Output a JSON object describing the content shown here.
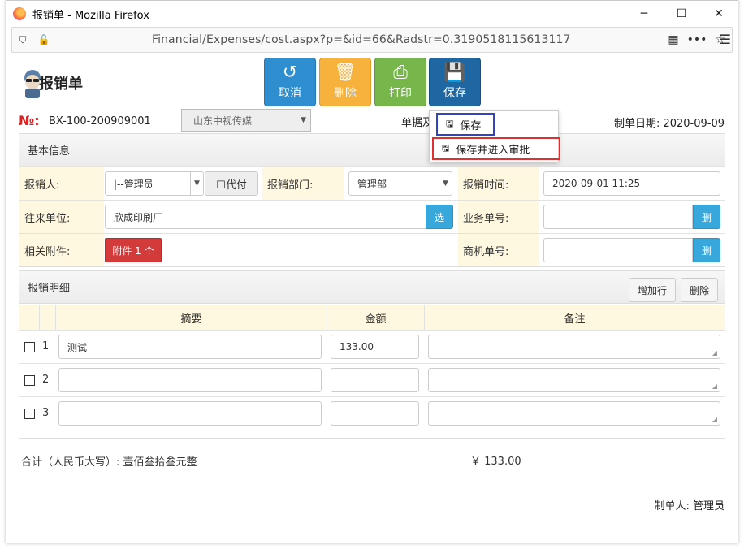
{
  "browser": {
    "window_title": "报销单 - Mozilla Firefox",
    "url": "Financial/Expenses/cost.aspx?p=&id=66&Radstr=0.3190518115613117",
    "minimize": "─",
    "maximize": "☐",
    "close": "✕"
  },
  "header": {
    "doc_title": "报销单",
    "no_label": "№:",
    "no_value": "BX-100-200909001",
    "company": "山东中视传媒",
    "doc_date_label": "单据及",
    "make_date": "制单日期: 2020-09-09"
  },
  "toolbar": {
    "cancel": "取消",
    "delete": "删除",
    "print": "打印",
    "save": "保存"
  },
  "save_menu": {
    "save": "保存",
    "save_submit": "保存并进入审批"
  },
  "basic": {
    "title": "基本信息",
    "applicant_label": "报销人:",
    "applicant_value": "|--管理员",
    "proxy_label": "☐代付",
    "dept_label": "报销部门:",
    "dept_value": "管理部",
    "time_label": "报销时间:",
    "time_value": "2020-09-01 11:25",
    "partner_label": "往来单位:",
    "partner_value": "欣成印刷厂",
    "partner_btn": "选",
    "bizno_label": "业务单号:",
    "bizno_btn": "删",
    "attach_label": "相关附件:",
    "attach_btn": "附件 1 个",
    "oppno_label": "商机单号:",
    "oppno_btn": "删"
  },
  "detail": {
    "title": "报销明细",
    "add_row": "增加行",
    "delete": "删除",
    "columns": [
      "摘要",
      "金额",
      "备注"
    ],
    "rows": [
      {
        "num": "1",
        "summary": "测试",
        "amount": "133.00",
        "note": ""
      },
      {
        "num": "2",
        "summary": "",
        "amount": "",
        "note": ""
      },
      {
        "num": "3",
        "summary": "",
        "amount": "",
        "note": ""
      }
    ]
  },
  "total": {
    "label": "合计（人民币大写）: 壹佰叁拾叁元整",
    "amount": "￥ 133.00"
  },
  "footer": {
    "maker": "制单人: 管理员"
  },
  "colors": {
    "cancel": "#2e8ed0",
    "delete": "#f7b23e",
    "print": "#77b64b",
    "save": "#1f67a3",
    "label_bg": "#fff8e1",
    "highlight_blue": "#2d46c9",
    "highlight_red": "#e03030"
  }
}
